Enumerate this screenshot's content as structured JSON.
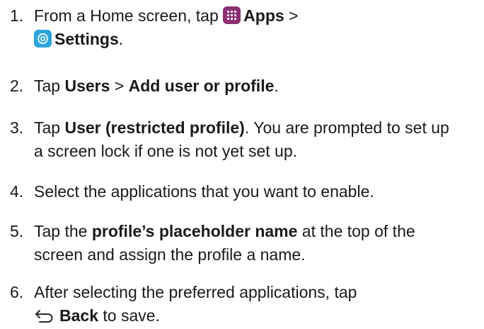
{
  "steps": [
    {
      "num": "1.",
      "line1_pre": "From a Home screen, tap ",
      "apps_label": "Apps",
      "line1_post": " >",
      "settings_label": "Settings",
      "line2_post": "."
    },
    {
      "num": "2.",
      "pre": "Tap ",
      "users_label": "Users",
      "mid": " > ",
      "add_label": "Add user or profile",
      "post": "."
    },
    {
      "num": "3.",
      "pre": "Tap ",
      "restricted_label": "User (restricted profile)",
      "post": ". You are prompted to set up a screen lock if one is not yet set up."
    },
    {
      "num": "4.",
      "text": "Select the applications that you want to enable."
    },
    {
      "num": "5.",
      "pre": "Tap the ",
      "placeholder_label": "profile’s placeholder name",
      "post": " at the top of the screen and assign the profile a name."
    },
    {
      "num": "6.",
      "pre": "After selecting the preferred applications, tap",
      "back_label": "Back",
      "post": " to save."
    }
  ],
  "icons": {
    "apps": "apps-icon",
    "settings": "settings-icon",
    "back": "back-icon"
  },
  "colors": {
    "apps_icon_bg": "#8b2f72",
    "settings_icon_bg": "#2ba3dc",
    "text": "#1a1a1a"
  }
}
